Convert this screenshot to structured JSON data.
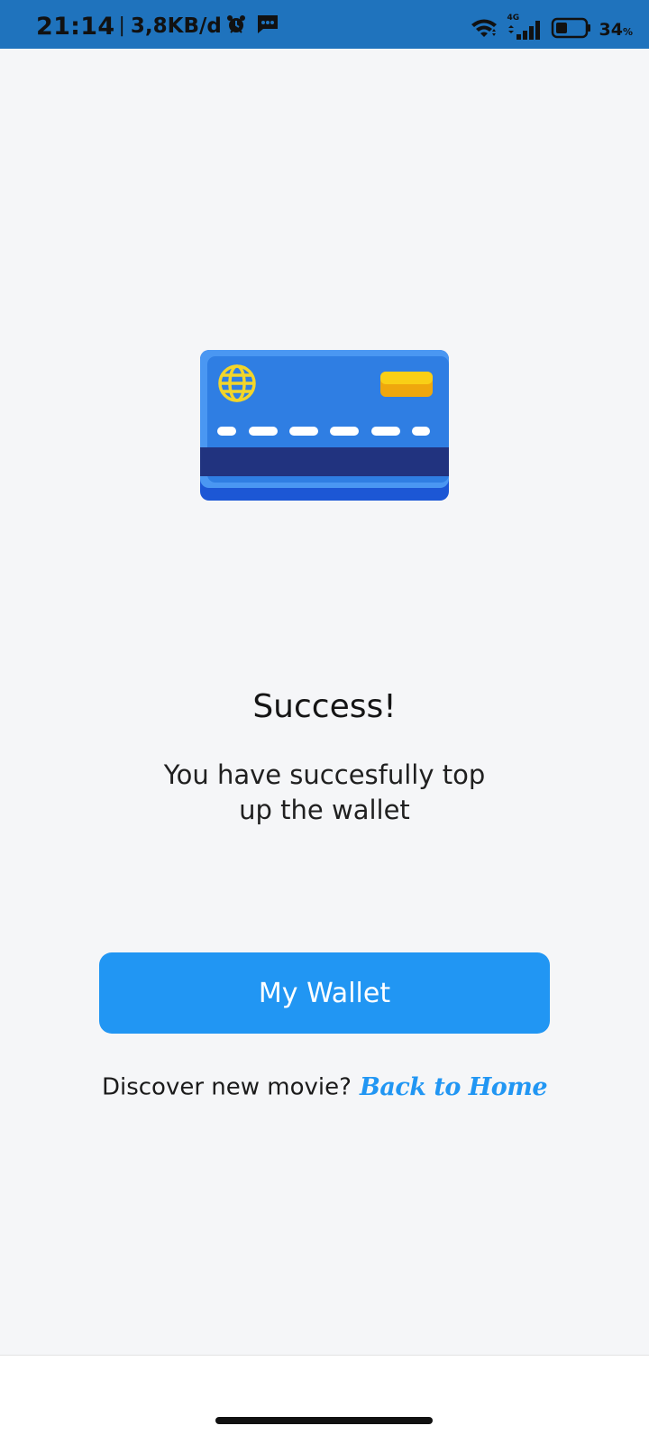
{
  "status_bar": {
    "time": "21:14",
    "separator": "|",
    "network_speed": "3,8KB/d",
    "network_type": "4G",
    "battery_percent": "34",
    "battery_unit": "%",
    "icons": [
      "alarm-icon",
      "message-icon",
      "wifi-icon",
      "signal-icon",
      "battery-icon"
    ]
  },
  "illustration": {
    "icon": "credit-card-icon",
    "colors": {
      "card": "#2f7ee3",
      "card_edge": "#4a97f2",
      "stripe": "#21337f",
      "chip_top": "#f9cf16",
      "chip_bottom": "#efa70d",
      "globe": "#f2d52a"
    }
  },
  "success": {
    "title": "Success!",
    "message": "You have succesfully top up the wallet"
  },
  "primary_button": {
    "label": "My Wallet",
    "color": "#2196f3"
  },
  "footer": {
    "prompt": "Discover new movie?",
    "link_label": "Back to Home",
    "link_color": "#2196f3"
  }
}
